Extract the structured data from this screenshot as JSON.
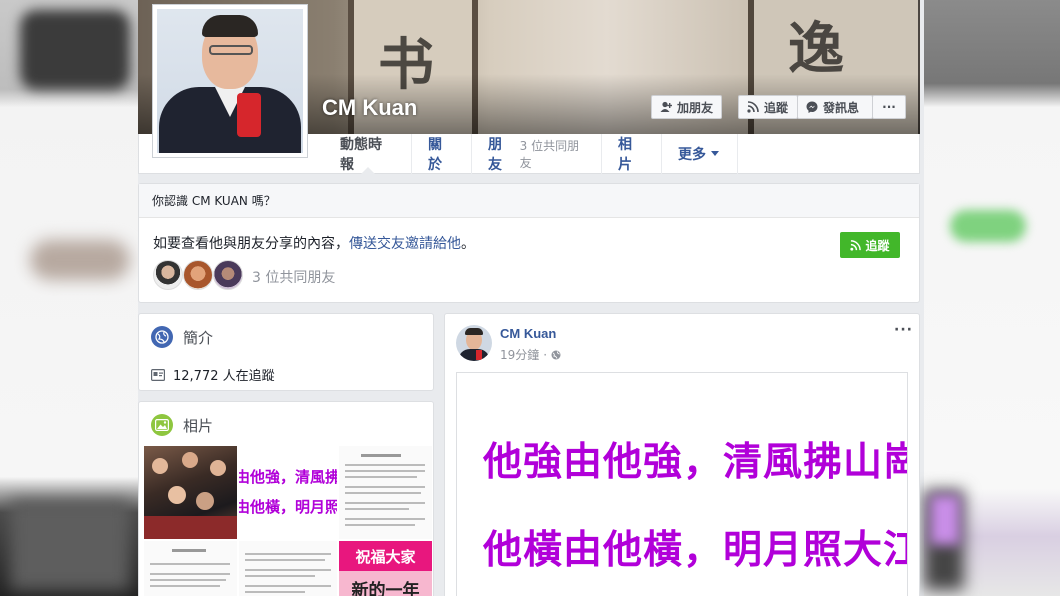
{
  "profile": {
    "name": "CM Kuan",
    "buttons": {
      "add_friend": "加朋友",
      "follow": "追蹤",
      "message": "發訊息",
      "more": "···"
    }
  },
  "tabs": [
    {
      "label": "動態時報"
    },
    {
      "label": "關於"
    },
    {
      "label": "朋友",
      "sub": "3 位共同朋友"
    },
    {
      "label": "相片"
    },
    {
      "label": "更多"
    }
  ],
  "know_box": {
    "title": "你認識 CM KUAN 嗎？",
    "text_prefix": "如要查看他與朋友分享的內容，",
    "text_link": "傳送交友邀請給他",
    "text_suffix": "。",
    "follow_label": "追蹤",
    "mutual_friends": "3 位共同朋友"
  },
  "intro": {
    "title": "簡介",
    "followers": "12,772 人在追蹤"
  },
  "photos": {
    "title": "相片",
    "thumb_text_1a": "由他強，清風拂山",
    "thumb_text_1b": "由他橫，明月照大",
    "thumb_text_2a": "祝福大家",
    "thumb_text_2b": "新的一年"
  },
  "post": {
    "author": "CM Kuan",
    "time": "19分鐘",
    "more": "···",
    "line1": "他強由他強，清風拂山崗；",
    "line2": "他橫由他橫，明月照大江。"
  },
  "colors": {
    "link": "#365899",
    "green": "#42b72a",
    "poem_purple": "#b100d9",
    "page_bg": "#e9ebee"
  }
}
